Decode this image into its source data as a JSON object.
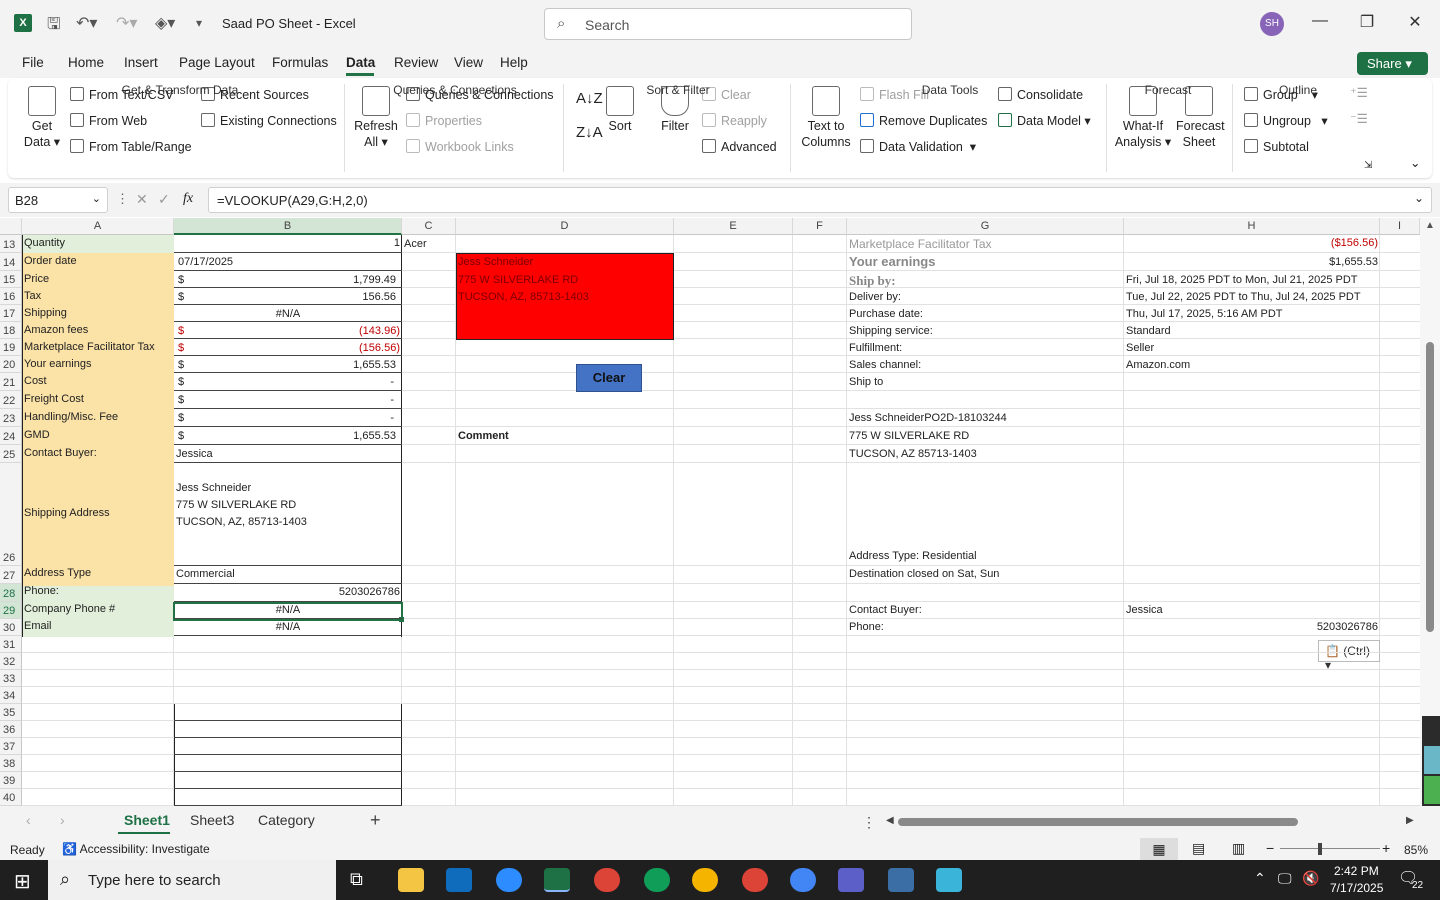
{
  "app": {
    "title": "Saad PO Sheet  -  Excel",
    "search_placeholder": "Search",
    "avatar_initials": "SH"
  },
  "menu": {
    "items": [
      "File",
      "Home",
      "Insert",
      "Page Layout",
      "Formulas",
      "Data",
      "Review",
      "View",
      "Help"
    ],
    "active": "Data",
    "share": "Share"
  },
  "ribbon": {
    "get_data": "Get Data",
    "from_text": "From Text/CSV",
    "from_web": "From Web",
    "from_table": "From Table/Range",
    "recent_sources": "Recent Sources",
    "existing_connections": "Existing Connections",
    "group_get_transform": "Get & Transform Data",
    "refresh_all": "Refresh All",
    "queries_connections": "Queries & Connections",
    "properties": "Properties",
    "workbook_links": "Workbook Links",
    "group_queries": "Queries & Connections",
    "sort": "Sort",
    "filter": "Filter",
    "clear": "Clear",
    "reapply": "Reapply",
    "advanced": "Advanced",
    "group_sort_filter": "Sort & Filter",
    "text_to_columns": "Text to Columns",
    "flash_fill": "Flash Fill",
    "remove_duplicates": "Remove Duplicates",
    "data_validation": "Data Validation",
    "consolidate": "Consolidate",
    "data_model": "Data Model",
    "group_data_tools": "Data Tools",
    "what_if": "What-If Analysis",
    "forecast_sheet": "Forecast Sheet",
    "group_forecast": "Forecast",
    "group": "Group",
    "ungroup": "Ungroup",
    "subtotal": "Subtotal",
    "group_outline": "Outline"
  },
  "formula_bar": {
    "name_box": "B28",
    "fx": "fx",
    "formula": "=VLOOKUP(A29,G:H,2,0)"
  },
  "columns": [
    "A",
    "B",
    "C",
    "D",
    "E",
    "F",
    "G",
    "H",
    "I"
  ],
  "rows": [
    13,
    14,
    15,
    16,
    17,
    18,
    19,
    20,
    21,
    22,
    23,
    24,
    25,
    26,
    27,
    28,
    29,
    30,
    31,
    32,
    33,
    34,
    35,
    36,
    37,
    38,
    39,
    40
  ],
  "sheet": {
    "labels": [
      "Quantity",
      "Order date",
      "Price",
      "Tax",
      "Shipping",
      "Amazon fees",
      "Marketplace Facilitator Tax",
      "Your earnings",
      "Cost",
      "Freight Cost",
      "Handling/Misc. Fee",
      "GMD",
      "Contact Buyer:",
      "Shipping Address",
      "Address Type",
      "Phone:",
      "Company Phone #",
      "Email"
    ],
    "b13": "1",
    "c13": "Acer",
    "b14": "07/17/2025",
    "cur": "$",
    "b15": "1,799.49",
    "b16": "156.56",
    "b17": "#N/A",
    "b18": "(143.96)",
    "b19": "(156.56)",
    "b20": "1,655.53",
    "b21": "-",
    "b22": "-",
    "b23": "-",
    "b24": "1,655.53",
    "b25": "Jessica",
    "addr1": "Jess Schneider",
    "addr2": "775 W SILVERLAKE RD",
    "addr3": "TUCSON, AZ, 85713-1403",
    "b27": "Commercial",
    "b28": "5203026786",
    "b29": "#N/A",
    "b30": "#N/A",
    "d14": "Jess Schneider",
    "d15": "775 W SILVERLAKE RD",
    "d16": "TUCSON, AZ, 85713-1403",
    "d24": "Comment",
    "clear_button": "Clear",
    "g13": "Marketplace Facilitator Tax",
    "h13": "($156.56)",
    "g14": "Your earnings",
    "h14": "$1,655.53",
    "g15": "Ship by:",
    "h15": "Fri, Jul 18, 2025 PDT to Mon, Jul 21, 2025 PDT",
    "g16": "Deliver by:",
    "h16": "Tue, Jul 22, 2025 PDT to Thu, Jul 24, 2025 PDT",
    "g17": "Purchase date:",
    "h17": "Thu, Jul 17, 2025, 5:16 AM PDT",
    "g18": "Shipping service:",
    "h18": "Standard",
    "g19": "Fulfillment:",
    "h19": "Seller",
    "g20": "Sales channel:",
    "h20": "Amazon.com",
    "g21": "Ship to",
    "g23": "Jess SchneiderPO2D-18103244",
    "g24": "775 W SILVERLAKE RD",
    "g25": "TUCSON, AZ 85713-1403",
    "g26": "Address Type:  Residential",
    "g27": "Destination closed on Sat, Sun",
    "g28": "",
    "g29": "Contact Buyer:",
    "h29": "Jessica",
    "g30": "Phone:",
    "h30": "5203026786",
    "ctrl": "(Ctrl)"
  },
  "tabs": [
    "Sheet1",
    "Sheet3",
    "Category"
  ],
  "active_tab": "Sheet1",
  "status": {
    "ready": "Ready",
    "accessibility": "Accessibility: Investigate",
    "zoom": "85%"
  },
  "taskbar": {
    "search": "Type here to search",
    "time": "2:42 PM",
    "date": "7/17/2025",
    "notif": "22"
  },
  "colors": {
    "excel_green": "#217346",
    "label_fill": "#fbe2a7",
    "green_fill": "#e2efda",
    "red_fill": "#ff0000",
    "button_blue": "#4472c4"
  }
}
